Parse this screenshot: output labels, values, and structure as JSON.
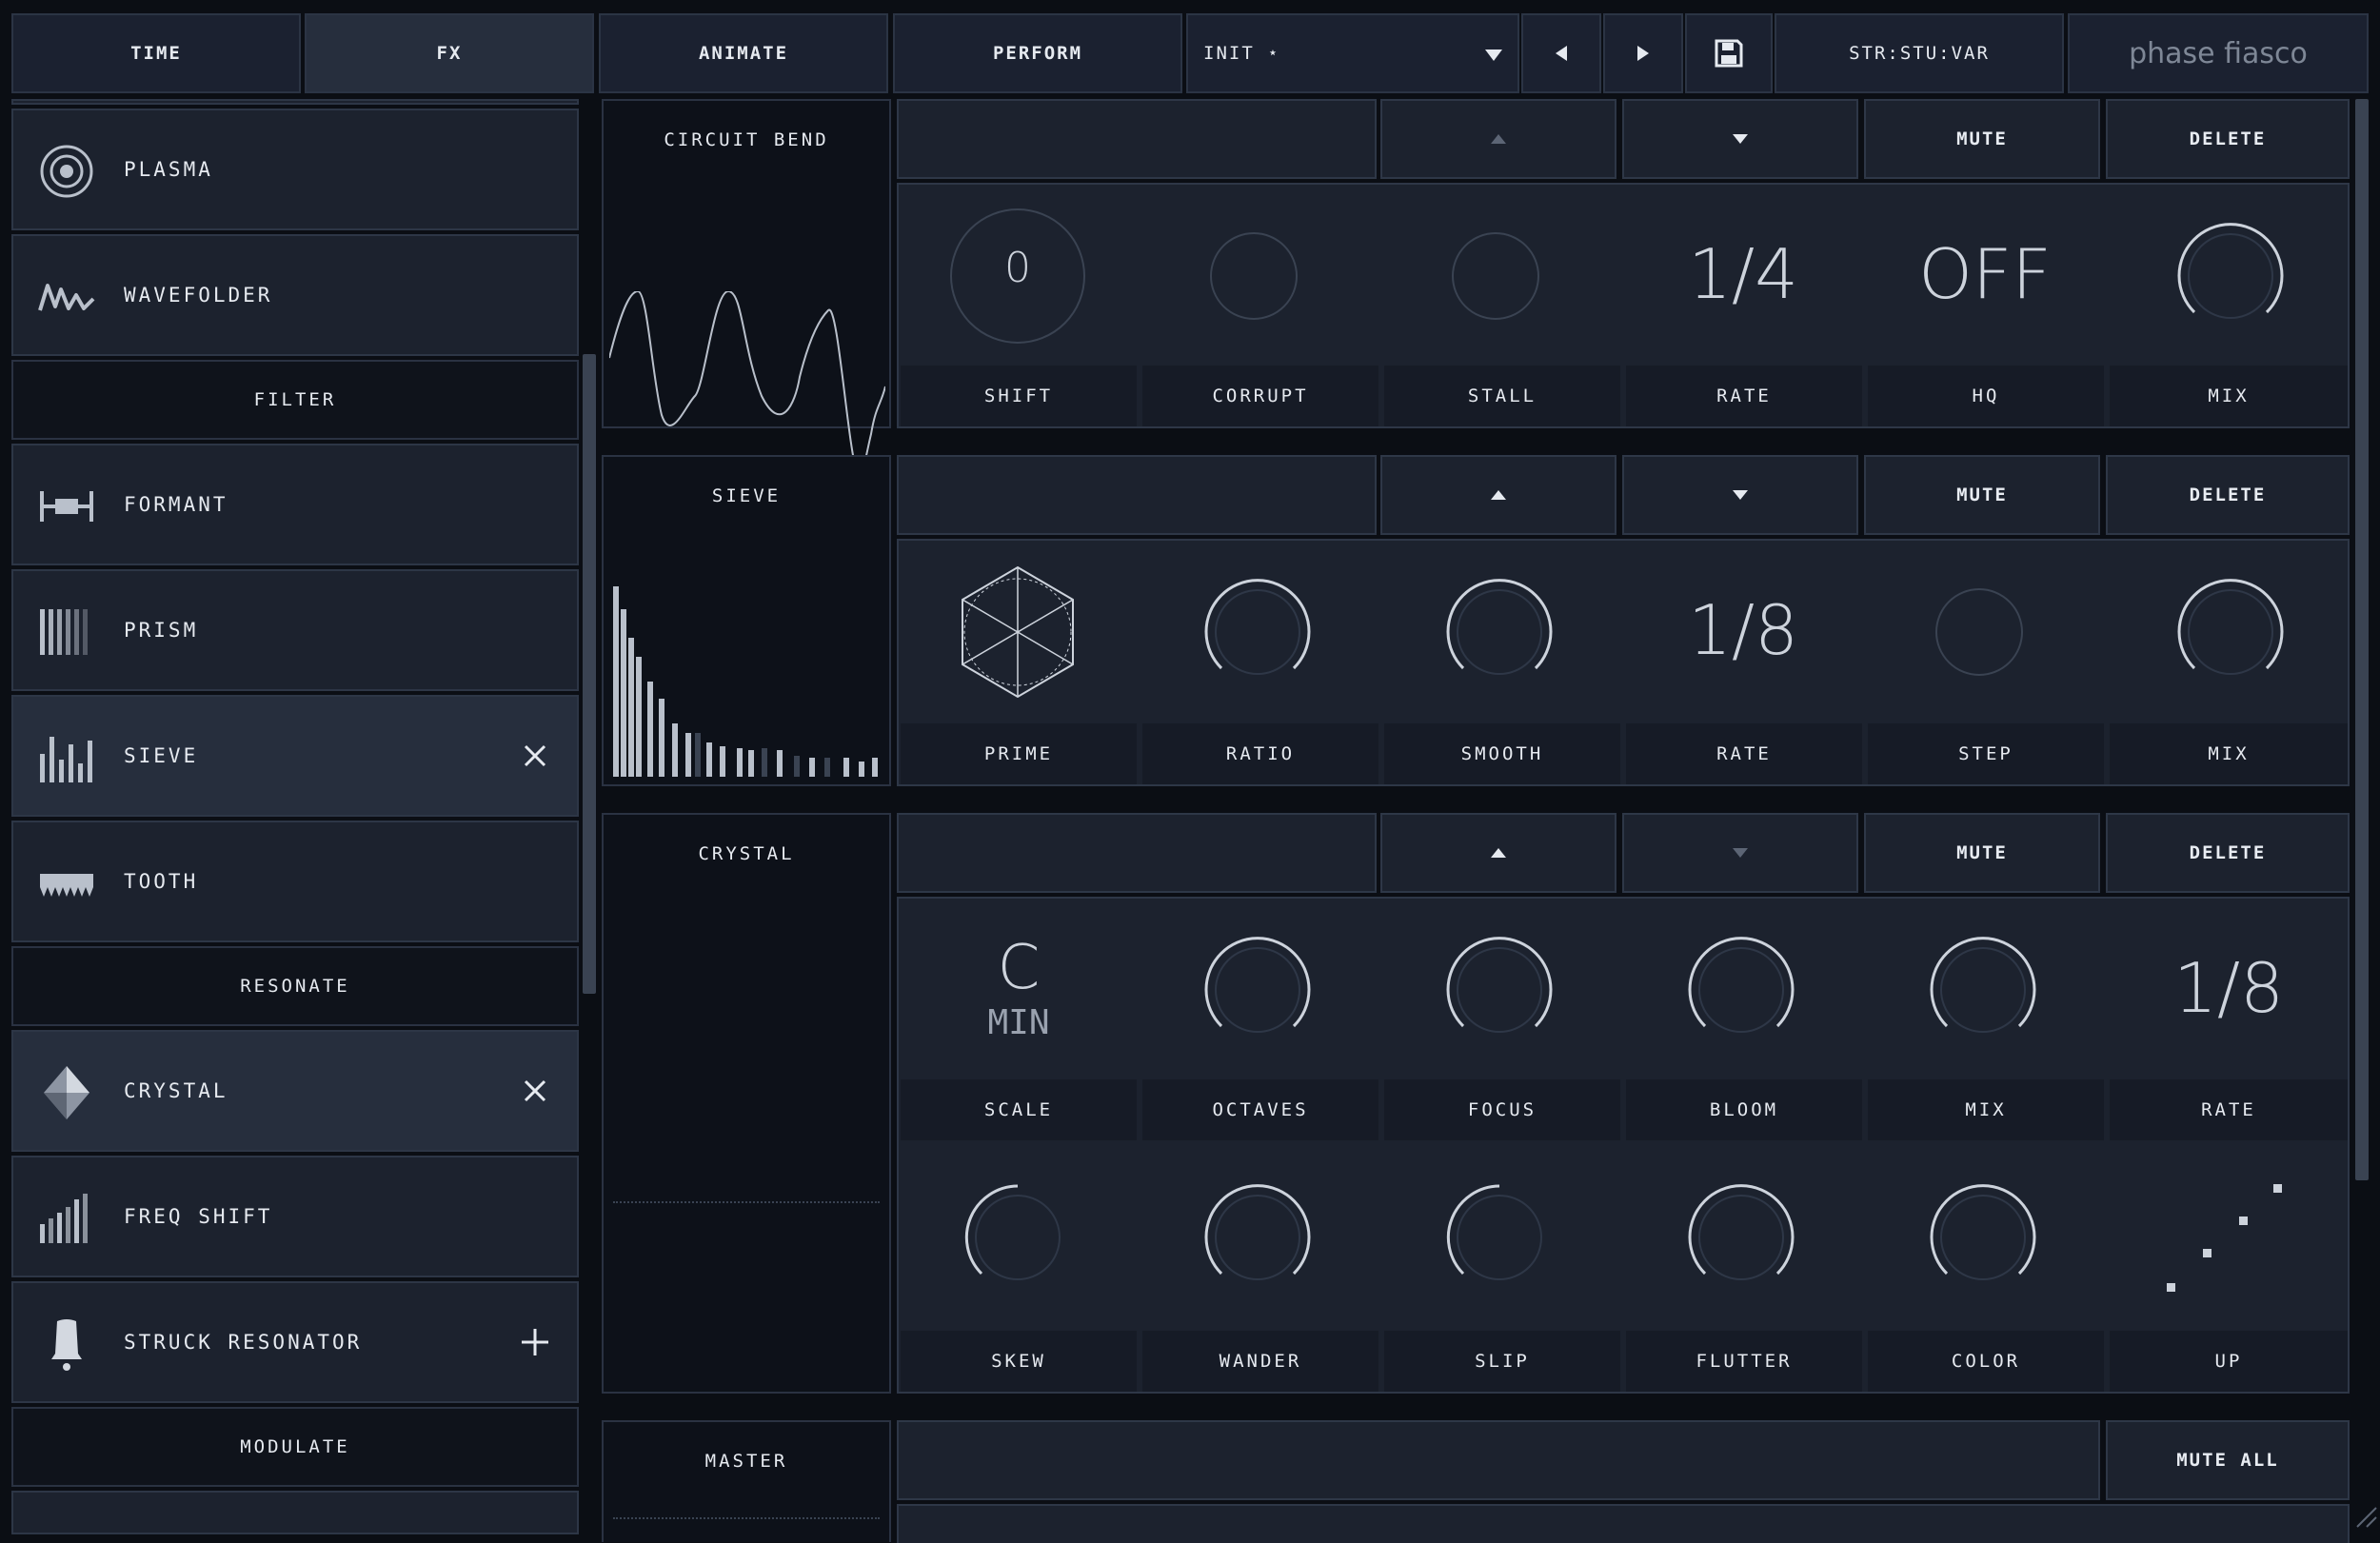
{
  "nav": {
    "time": "TIME",
    "fx": "FX",
    "animate": "ANIMATE",
    "perform": "PERFORM",
    "preset": "INIT ⋆",
    "state": "STR:STU:VAR",
    "brand": "phase fiasco"
  },
  "sidebar": {
    "items": [
      {
        "label": "PLASMA",
        "icon": "target-icon"
      },
      {
        "label": "WAVEFOLDER",
        "icon": "wave-fold-icon"
      },
      {
        "label": "FORMANT",
        "icon": "formant-icon"
      },
      {
        "label": "PRISM",
        "icon": "prism-bars-icon"
      },
      {
        "label": "SIEVE",
        "icon": "sieve-bars-icon"
      },
      {
        "label": "TOOTH",
        "icon": "tooth-icon"
      },
      {
        "label": "CRYSTAL",
        "icon": "diamond-icon"
      },
      {
        "label": "FREQ SHIFT",
        "icon": "freq-shift-icon"
      },
      {
        "label": "STRUCK RESONATOR",
        "icon": "bell-icon"
      }
    ],
    "headers": {
      "filter": "FILTER",
      "resonate": "RESONATE",
      "modulate": "MODULATE"
    }
  },
  "fx": {
    "circuit_bend": {
      "title": "CIRCUIT BEND",
      "mute": "MUTE",
      "delete": "DELETE",
      "knob_value": "0",
      "rate": "1/4",
      "hq": "OFF",
      "labels": [
        "SHIFT",
        "CORRUPT",
        "STALL",
        "RATE",
        "HQ",
        "MIX"
      ]
    },
    "sieve": {
      "title": "SIEVE",
      "mute": "MUTE",
      "delete": "DELETE",
      "rate": "1/8",
      "labels": [
        "PRIME",
        "RATIO",
        "SMOOTH",
        "RATE",
        "STEP",
        "MIX"
      ]
    },
    "crystal": {
      "title": "CRYSTAL",
      "mute": "MUTE",
      "delete": "DELETE",
      "scale_note": "C",
      "scale_mode": "MIN",
      "rate": "1/8",
      "labels": [
        "SCALE",
        "OCTAVES",
        "FOCUS",
        "BLOOM",
        "MIX",
        "RATE"
      ],
      "labels2": [
        "SKEW",
        "WANDER",
        "SLIP",
        "FLUTTER",
        "COLOR",
        "UP"
      ]
    },
    "master": {
      "title": "MASTER",
      "mute_all": "MUTE ALL"
    }
  },
  "colors": {
    "accent": "#cdd3dc",
    "bg": "#0b0e14",
    "cell": "#1c222e",
    "border": "#2e3747"
  }
}
